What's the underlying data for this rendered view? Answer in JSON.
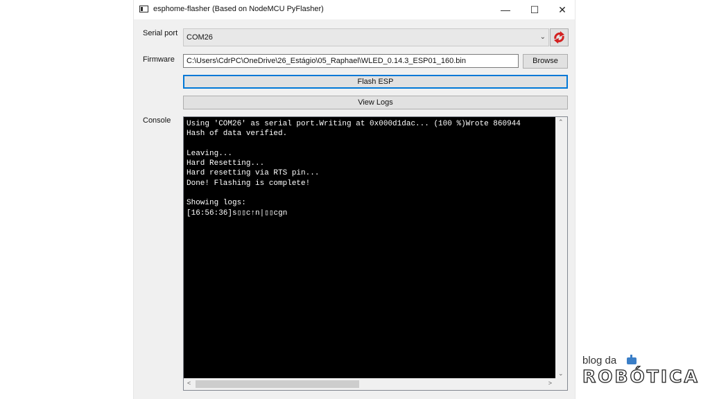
{
  "window": {
    "title": "esphome-flasher (Based on NodeMCU PyFlasher)",
    "controls": {
      "minimize": "—",
      "maximize": "☐",
      "close": "✕"
    }
  },
  "serial_port": {
    "label": "Serial port",
    "selected": "COM26"
  },
  "firmware": {
    "label": "Firmware",
    "path": "C:\\Users\\CdrPC\\OneDrive\\26_Estágio\\05_Raphael\\WLED_0.14.3_ESP01_160.bin",
    "browse_label": "Browse"
  },
  "actions": {
    "flash_label": "Flash ESP",
    "logs_label": "View Logs"
  },
  "console": {
    "label": "Console",
    "text": "Using 'COM26' as serial port.Writing at 0x000d1dac... (100 %)Wrote 860944\nHash of data verified.\n\nLeaving...\nHard Resetting...\nHard resetting via RTS pin...\nDone! Flashing is complete!\n\nShowing logs:\n[16:56:36]s▯▯c↑n|▯▯cgn"
  },
  "logo": {
    "top": "blog da",
    "bottom": "ROBÓTICA"
  },
  "colors": {
    "accent": "#0078d7",
    "console_bg": "#000000",
    "reload_icon": "#d32020"
  }
}
